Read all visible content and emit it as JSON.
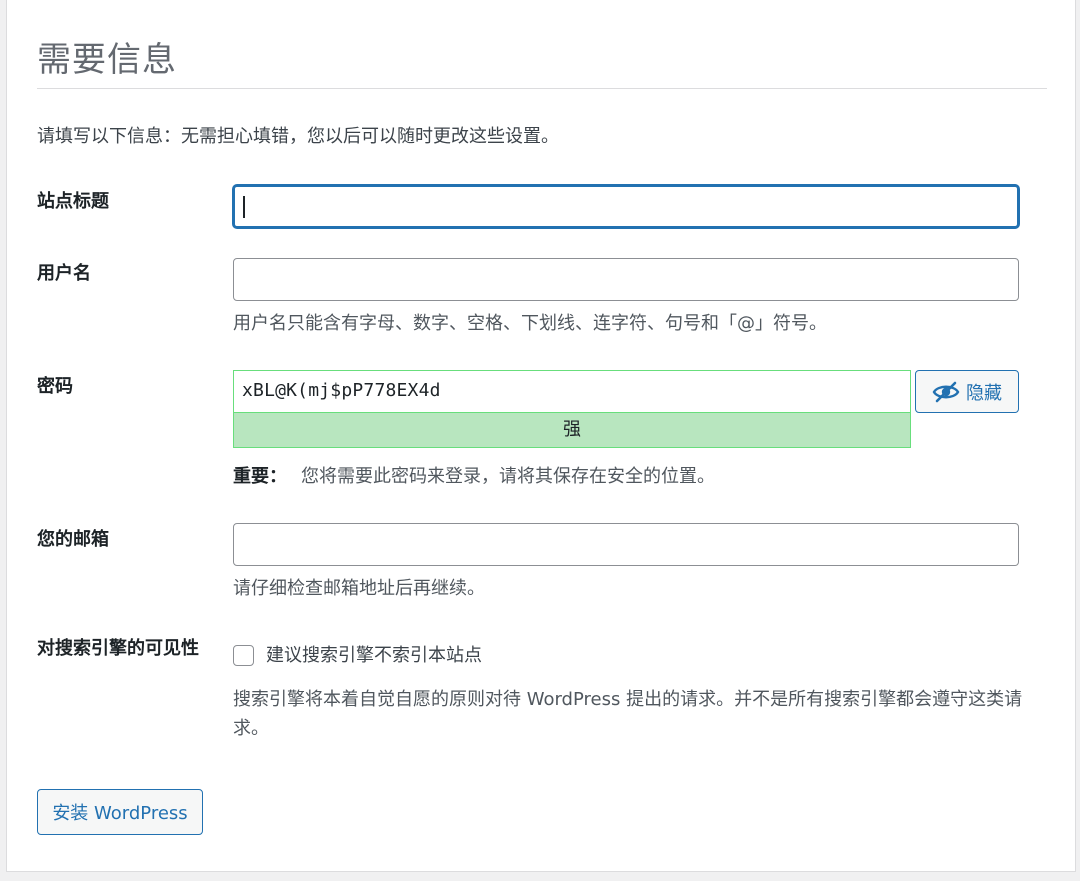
{
  "header": {
    "title": "需要信息",
    "intro": "请填写以下信息：无需担心填错，您以后可以随时更改这些设置。"
  },
  "fields": {
    "site_title": {
      "label": "站点标题",
      "value": ""
    },
    "username": {
      "label": "用户名",
      "value": "",
      "hint": "用户名只能含有字母、数字、空格、下划线、连字符、句号和「@」符号。"
    },
    "password": {
      "label": "密码",
      "value": "xBL@K(mj$pP778EX4d",
      "strength": "强",
      "toggle_label": "隐藏",
      "toggle_icon": "eye-slash-icon",
      "important_label": "重要：",
      "important_text": "您将需要此密码来登录，请将其保存在安全的位置。"
    },
    "email": {
      "label": "您的邮箱",
      "value": "",
      "hint": "请仔细检查邮箱地址后再继续。"
    },
    "search_visibility": {
      "label": "对搜索引擎的可见性",
      "checkbox_label": "建议搜索引擎不索引本站点",
      "checked": false,
      "hint": "搜索引擎将本着自觉自愿的原则对待 WordPress 提出的请求。并不是所有搜索引擎都会遵守这类请求。"
    }
  },
  "actions": {
    "install_label": "安装 WordPress"
  },
  "colors": {
    "accent": "#2271b1",
    "strength_bg": "#b8e6bf",
    "strength_border": "#68de7c"
  }
}
